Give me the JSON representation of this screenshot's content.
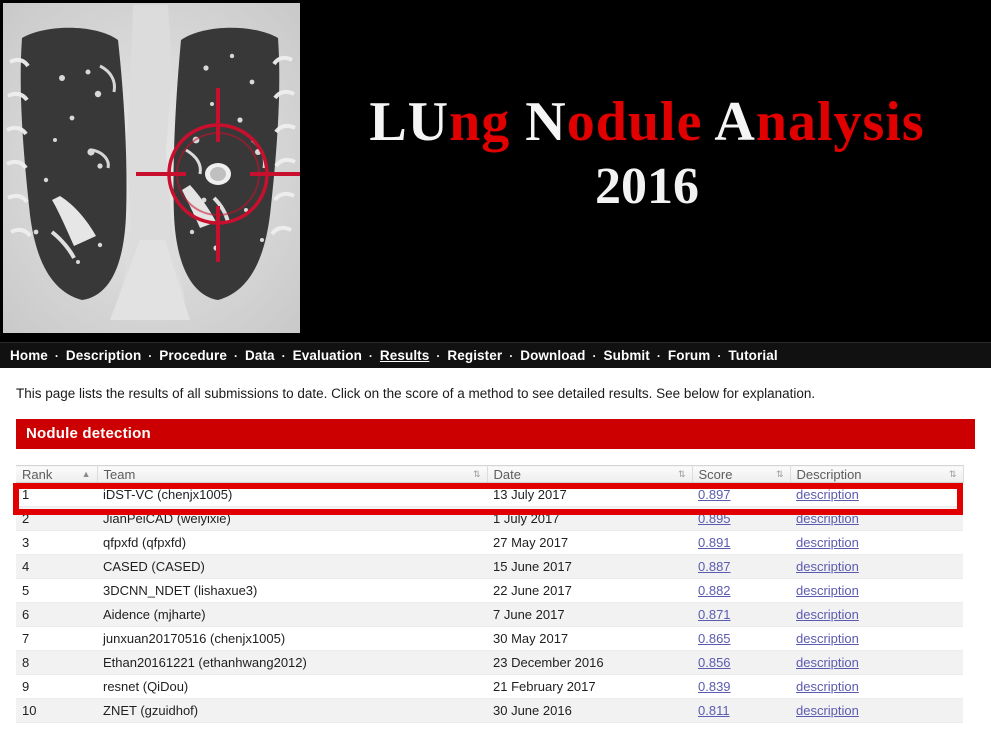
{
  "banner": {
    "title_parts": [
      {
        "text": "LU",
        "color": "white"
      },
      {
        "text": "ng ",
        "color": "red"
      },
      {
        "text": "N",
        "color": "white"
      },
      {
        "text": "odule ",
        "color": "red"
      },
      {
        "text": "A",
        "color": "white"
      },
      {
        "text": "nalysis",
        "color": "red"
      }
    ],
    "year": "2016",
    "image_alt": "coronal-chest-ct-with-nodule-crosshair",
    "colors": {
      "white": "#f5f5f5",
      "red": "#e00000",
      "background": "#000000"
    }
  },
  "nav": {
    "separator": "·",
    "items": [
      {
        "label": "Home",
        "active": false
      },
      {
        "label": "Description",
        "active": false
      },
      {
        "label": "Procedure",
        "active": false
      },
      {
        "label": "Data",
        "active": false
      },
      {
        "label": "Evaluation",
        "active": false
      },
      {
        "label": "Results",
        "active": true
      },
      {
        "label": "Register",
        "active": false
      },
      {
        "label": "Download",
        "active": false
      },
      {
        "label": "Submit",
        "active": false
      },
      {
        "label": "Forum",
        "active": false
      },
      {
        "label": "Tutorial",
        "active": false
      }
    ]
  },
  "intro": {
    "text": "This page lists the results of all submissions to date. Click on the score of a method to see detailed results. See below for explanation."
  },
  "section": {
    "title": "Nodule detection",
    "accent_color": "#cc0000"
  },
  "table": {
    "columns": [
      {
        "label": "Rank",
        "sort": "asc"
      },
      {
        "label": "Team",
        "sort": "none"
      },
      {
        "label": "Date",
        "sort": "none"
      },
      {
        "label": "Score",
        "sort": "none"
      },
      {
        "label": "Description",
        "sort": "none"
      }
    ],
    "sort_glyphs": {
      "asc": "▲",
      "none": "⇅"
    },
    "rows": [
      {
        "rank": "1",
        "team": "iDST-VC (chenjx1005)",
        "date": "13 July 2017",
        "score": "0.897",
        "description": "description"
      },
      {
        "rank": "2",
        "team": "JianPeiCAD (weiyixie)",
        "date": "1 July 2017",
        "score": "0.895",
        "description": "description"
      },
      {
        "rank": "3",
        "team": "qfpxfd (qfpxfd)",
        "date": "27 May 2017",
        "score": "0.891",
        "description": "description"
      },
      {
        "rank": "4",
        "team": "CASED (CASED)",
        "date": "15 June 2017",
        "score": "0.887",
        "description": "description"
      },
      {
        "rank": "5",
        "team": "3DCNN_NDET (lishaxue3)",
        "date": "22 June 2017",
        "score": "0.882",
        "description": "description"
      },
      {
        "rank": "6",
        "team": "Aidence (mjharte)",
        "date": "7 June 2017",
        "score": "0.871",
        "description": "description"
      },
      {
        "rank": "7",
        "team": "junxuan20170516 (chenjx1005)",
        "date": "30 May 2017",
        "score": "0.865",
        "description": "description"
      },
      {
        "rank": "8",
        "team": "Ethan20161221 (ethanhwang2012)",
        "date": "23 December 2016",
        "score": "0.856",
        "description": "description"
      },
      {
        "rank": "9",
        "team": "resnet (QiDou)",
        "date": "21 February 2017",
        "score": "0.839",
        "description": "description"
      },
      {
        "rank": "10",
        "team": "ZNET (gzuidhof)",
        "date": "30 June 2016",
        "score": "0.811",
        "description": "description"
      }
    ],
    "highlight": {
      "row_index": 0,
      "color": "#e10000"
    }
  }
}
